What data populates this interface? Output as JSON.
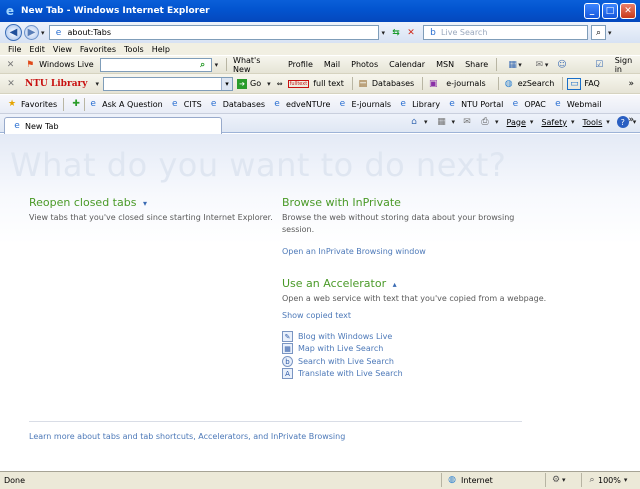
{
  "window": {
    "title": "New Tab - Windows Internet Explorer"
  },
  "address": {
    "url": "about:Tabs",
    "search_placeholder": "Live Search"
  },
  "menu": [
    "File",
    "Edit",
    "View",
    "Favorites",
    "Tools",
    "Help"
  ],
  "windows_live_toolbar": {
    "brand": "Windows Live",
    "links": [
      "What's New",
      "Profile",
      "Mail",
      "Photos",
      "Calendar",
      "MSN",
      "Share"
    ],
    "sign_in": "Sign in"
  },
  "ntu_toolbar": {
    "brand": "NTU Library",
    "go": "Go",
    "fulltext_badge": "fulltext",
    "fulltext": "full text",
    "databases": "Databases",
    "ejournals": "e-journals",
    "ezsearch": "ezSearch",
    "faq": "FAQ"
  },
  "favorites_bar": {
    "label": "Favorites",
    "items": [
      "Ask A Question",
      "CITS",
      "Databases",
      "edveNTUre",
      "E-journals",
      "Library",
      "NTU Portal",
      "OPAC",
      "Webmail"
    ]
  },
  "tab": {
    "label": "New Tab"
  },
  "command_bar": {
    "page": "Page",
    "safety": "Safety",
    "tools": "Tools"
  },
  "content": {
    "headline": "What do you want to do next?",
    "reopen": {
      "title": "Reopen closed tabs",
      "desc": "View tabs that you've closed since starting Internet Explorer."
    },
    "inprivate": {
      "title": "Browse with InPrivate",
      "desc1": "Browse the web without storing data about your browsing",
      "desc2": "session.",
      "link": "Open an InPrivate Browsing window"
    },
    "accelerator": {
      "title": "Use an Accelerator",
      "desc": "Open a web service with text that you've copied from a webpage.",
      "show": "Show copied text",
      "items": [
        "Blog with Windows Live",
        "Map with Live Search",
        "Search with Live Search",
        "Translate with Live Search"
      ]
    },
    "learn_more": "Learn more about tabs and tab shortcuts, Accelerators, and InPrivate Browsing"
  },
  "status": {
    "left": "Done",
    "zone": "Internet",
    "zoom": "100%"
  },
  "colors": {
    "heading_green": "#4a9a28",
    "link_blue": "#4d79b8",
    "titlebar_blue": "#0355d0"
  }
}
